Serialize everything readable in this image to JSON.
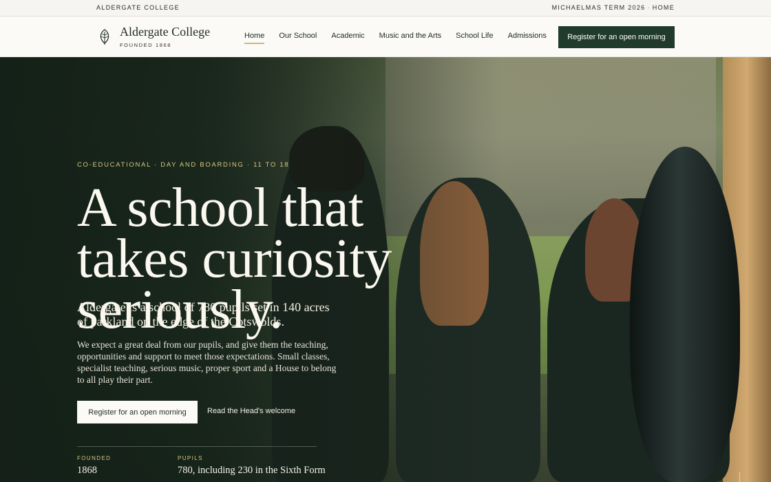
{
  "utility": {
    "school_name": "ALDERGATE COLLEGE",
    "term": "MICHAELMAS TERM 2026",
    "separator": "·",
    "home_link": "HOME"
  },
  "header": {
    "brand_name": "Aldergate College",
    "brand_founded": "FOUNDED 1868",
    "logo_icon": "leaf-icon",
    "nav": [
      "Home",
      "Our School",
      "Academic",
      "Music and the Arts",
      "School Life",
      "Admissions"
    ],
    "active_nav": "Home",
    "cta_label": "Register for an open morning"
  },
  "hero": {
    "kicker": "CO-EDUCATIONAL · DAY AND BOARDING · 11 TO 18",
    "headline": "A school that takes curiosity seriously.",
    "lede": "Aldergate is a school of 780 pupils set in 140 acres of parkland on the edge of the Cotswolds.",
    "body": "We expect a great deal from our pupils, and give them the teaching, opportunities and support to meet those expectations. Small classes, specialist teaching, serious music, proper sport and a House to belong to all play their part.",
    "cta_label": "Register for an open morning",
    "link_label": "Read the Head's welcome",
    "facts": [
      {
        "label": "FOUNDED",
        "value": "1868"
      },
      {
        "label": "PUPILS",
        "value": "780, including 230 in the Sixth Form"
      }
    ]
  },
  "colors": {
    "brand_green": "#203b2c",
    "accent_gold": "#d8c783",
    "header_bg": "#fbfaf7"
  }
}
